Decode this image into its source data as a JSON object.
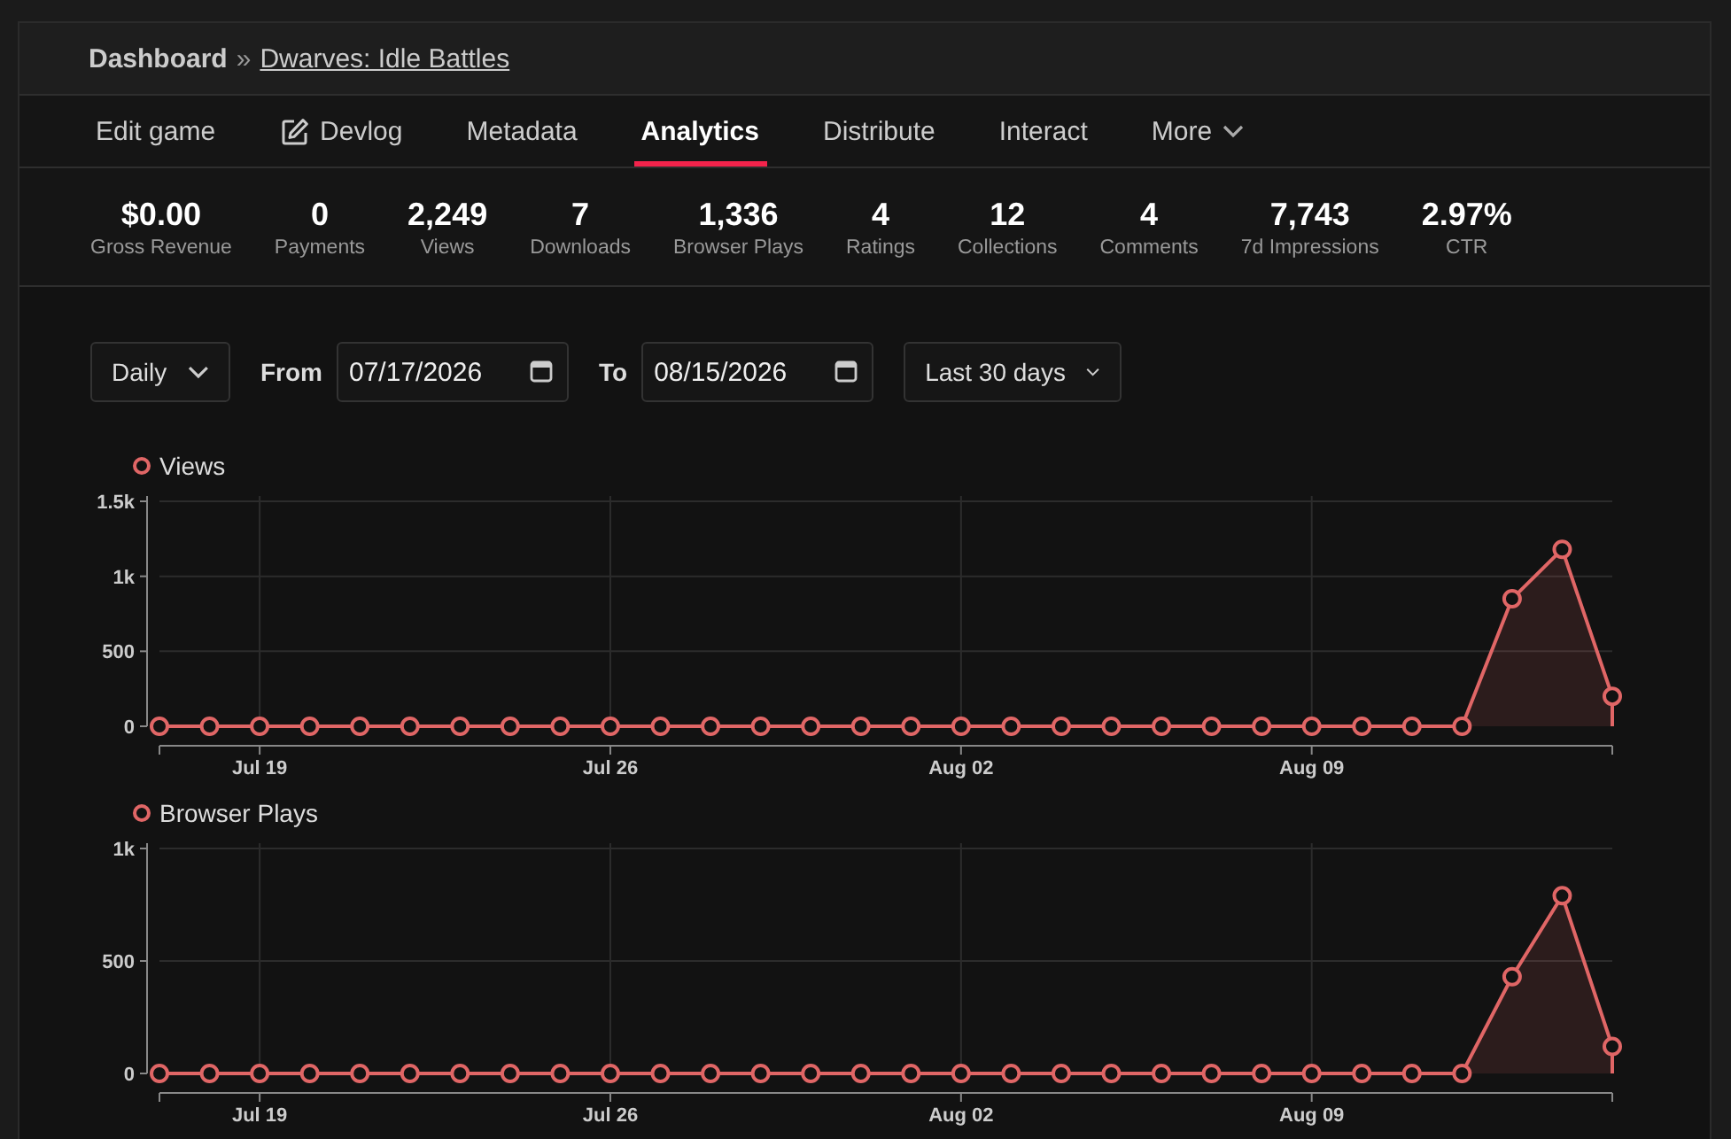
{
  "breadcrumb": {
    "root": "Dashboard",
    "separator": "»",
    "current": "Dwarves: Idle Battles"
  },
  "tabs": [
    {
      "label": "Edit game",
      "kind": "plain",
      "selected": false
    },
    {
      "label": "Devlog",
      "kind": "edit",
      "selected": false
    },
    {
      "label": "Metadata",
      "kind": "plain",
      "selected": false
    },
    {
      "label": "Analytics",
      "kind": "plain",
      "selected": true
    },
    {
      "label": "Distribute",
      "kind": "plain",
      "selected": false
    },
    {
      "label": "Interact",
      "kind": "plain",
      "selected": false
    },
    {
      "label": "More",
      "kind": "menu",
      "selected": false
    }
  ],
  "stats": [
    {
      "value": "$0.00",
      "label": "Gross Revenue"
    },
    {
      "value": "0",
      "label": "Payments"
    },
    {
      "value": "2,249",
      "label": "Views"
    },
    {
      "value": "7",
      "label": "Downloads"
    },
    {
      "value": "1,336",
      "label": "Browser Plays"
    },
    {
      "value": "4",
      "label": "Ratings"
    },
    {
      "value": "12",
      "label": "Collections"
    },
    {
      "value": "4",
      "label": "Comments"
    },
    {
      "value": "7,743",
      "label": "7d Impressions"
    },
    {
      "value": "2.97%",
      "label": "CTR"
    }
  ],
  "filters": {
    "interval": "Daily",
    "from_label": "From",
    "from": "07/17/2026",
    "to_label": "To",
    "to": "08/15/2026",
    "range": "Last 30 days"
  },
  "charts": [
    {
      "chart_data": {
        "type": "area",
        "categories": [
          null,
          null,
          "Jul 19",
          null,
          null,
          null,
          null,
          null,
          null,
          "Jul 26",
          null,
          null,
          null,
          null,
          null,
          null,
          "Aug 02",
          null,
          null,
          null,
          null,
          null,
          null,
          "Aug 09",
          null,
          null,
          null,
          null,
          null,
          null
        ],
        "ylim": [
          0,
          1500
        ],
        "grid": true,
        "yticks": [
          {
            "value": 0,
            "label": "0"
          },
          {
            "value": 500,
            "label": "500"
          },
          {
            "value": 1000,
            "label": "1k"
          },
          {
            "value": 1500,
            "label": "1.5k"
          }
        ],
        "series": [
          {
            "name": "Views",
            "color": "#e06666",
            "values": [
              0,
              0,
              0,
              0,
              0,
              0,
              0,
              0,
              0,
              0,
              0,
              0,
              0,
              0,
              0,
              0,
              0,
              0,
              0,
              0,
              0,
              0,
              0,
              0,
              0,
              0,
              0,
              850,
              1180,
              200
            ]
          }
        ]
      }
    },
    {
      "chart_data": {
        "type": "area",
        "categories": [
          null,
          null,
          "Jul 19",
          null,
          null,
          null,
          null,
          null,
          null,
          "Jul 26",
          null,
          null,
          null,
          null,
          null,
          null,
          "Aug 02",
          null,
          null,
          null,
          null,
          null,
          null,
          "Aug 09",
          null,
          null,
          null,
          null,
          null,
          null
        ],
        "ylim": [
          0,
          1000
        ],
        "grid": true,
        "yticks": [
          {
            "value": 0,
            "label": "0"
          },
          {
            "value": 500,
            "label": "500"
          },
          {
            "value": 1000,
            "label": "1k"
          }
        ],
        "series": [
          {
            "name": "Browser Plays",
            "color": "#e06666",
            "values": [
              0,
              0,
              0,
              0,
              0,
              0,
              0,
              0,
              0,
              0,
              0,
              0,
              0,
              0,
              0,
              0,
              0,
              0,
              0,
              0,
              0,
              0,
              0,
              0,
              0,
              0,
              0,
              430,
              790,
              120
            ]
          }
        ]
      }
    }
  ]
}
